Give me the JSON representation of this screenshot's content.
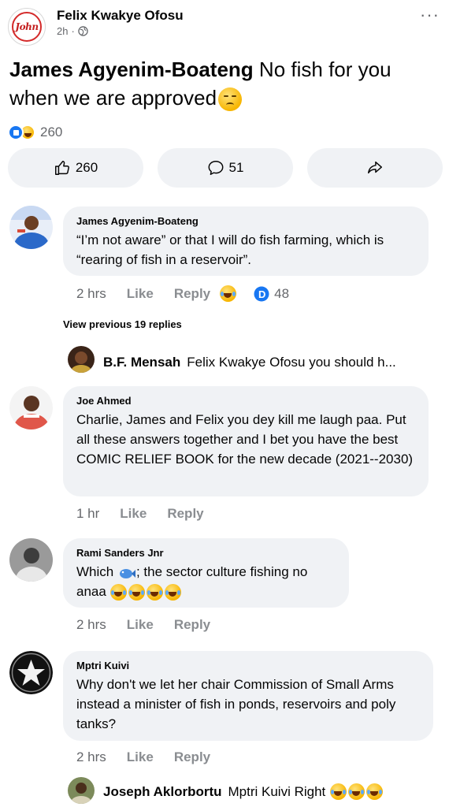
{
  "post": {
    "author": "Felix Kwakye Ofosu",
    "time": "2h",
    "separator": "·",
    "logo_text": "John",
    "mention": "James Agyenim-Boateng",
    "text": "No fish for you when we are approved",
    "reaction_count": "260",
    "like_count": "260",
    "comment_count": "51"
  },
  "comments": [
    {
      "name": "James Agyenim-Boateng",
      "text": "“I’m not aware” or that I will do fish farming, which is “rearing of fish in a reservoir”.",
      "time": "2 hrs",
      "like": "Like",
      "reply": "Reply",
      "reaction_count": "48"
    },
    {
      "name": "Joe Ahmed",
      "text": "Charlie, James and Felix you dey kill me laugh paa. Put all these answers together and I bet you have the best COMIC RELIEF BOOK for the new decade (2021--2030)",
      "time": "1 hr",
      "like": "Like",
      "reply": "Reply"
    },
    {
      "name": "Rami Sanders Jnr",
      "text_a": "Which",
      "text_b": "; the sector culture fishing no anaa",
      "time": "2 hrs",
      "like": "Like",
      "reply": "Reply"
    },
    {
      "name": "Mptri Kuivi",
      "text": "Why don't we let her chair Commission of Small Arms instead a minister of fish in  ponds, reservoirs and poly tanks?",
      "time": "2 hrs",
      "like": "Like",
      "reply": "Reply"
    }
  ],
  "view_previous": "View previous 19 replies",
  "replies": [
    {
      "name": "B.F. Mensah",
      "text": "Felix Kwakye Ofosu you should h..."
    },
    {
      "name": "Joseph Aklorbortu",
      "text": "Mptri Kuivi Right"
    }
  ],
  "colors": {
    "like_blue": "#1877f2",
    "bubble_bg": "#f0f2f5",
    "meta_gray": "#65676b"
  }
}
